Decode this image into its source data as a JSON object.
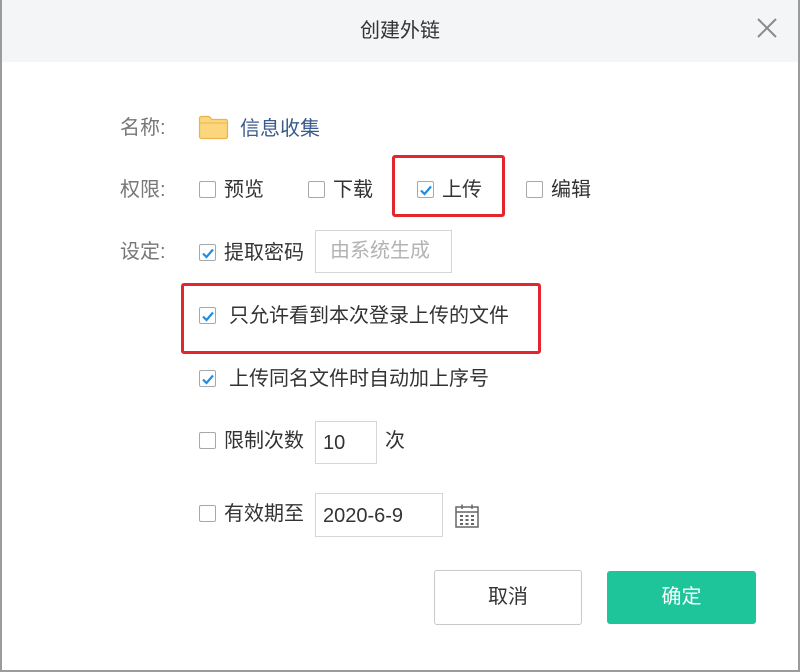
{
  "dialog": {
    "title": "创建外链"
  },
  "name_row": {
    "label": "名称:",
    "folder_name": "信息收集"
  },
  "permissions": {
    "label": "权限:",
    "preview": {
      "label": "预览",
      "checked": false
    },
    "download": {
      "label": "下载",
      "checked": false
    },
    "upload": {
      "label": "上传",
      "checked": true
    },
    "edit": {
      "label": "编辑",
      "checked": false
    }
  },
  "settings": {
    "label": "设定:",
    "extract_password": {
      "label": "提取密码",
      "checked": true,
      "placeholder": "由系统生成"
    },
    "only_own_uploads": {
      "label": "只允许看到本次登录上传的文件",
      "checked": true
    },
    "auto_number": {
      "label": "上传同名文件时自动加上序号",
      "checked": true
    },
    "limit_count": {
      "label": "限制次数",
      "checked": false,
      "value": "10",
      "unit": "次"
    },
    "expiry": {
      "label": "有效期至",
      "checked": false,
      "value": "2020-6-9"
    }
  },
  "buttons": {
    "cancel": "取消",
    "confirm": "确定"
  },
  "icons": {
    "close": "close-icon",
    "folder": "folder-icon",
    "calendar": "calendar-icon",
    "check": "check-icon"
  },
  "colors": {
    "accent": "#1ec49a",
    "check": "#1f8de3",
    "highlight": "#e3262c",
    "link": "#3a5a8c"
  }
}
